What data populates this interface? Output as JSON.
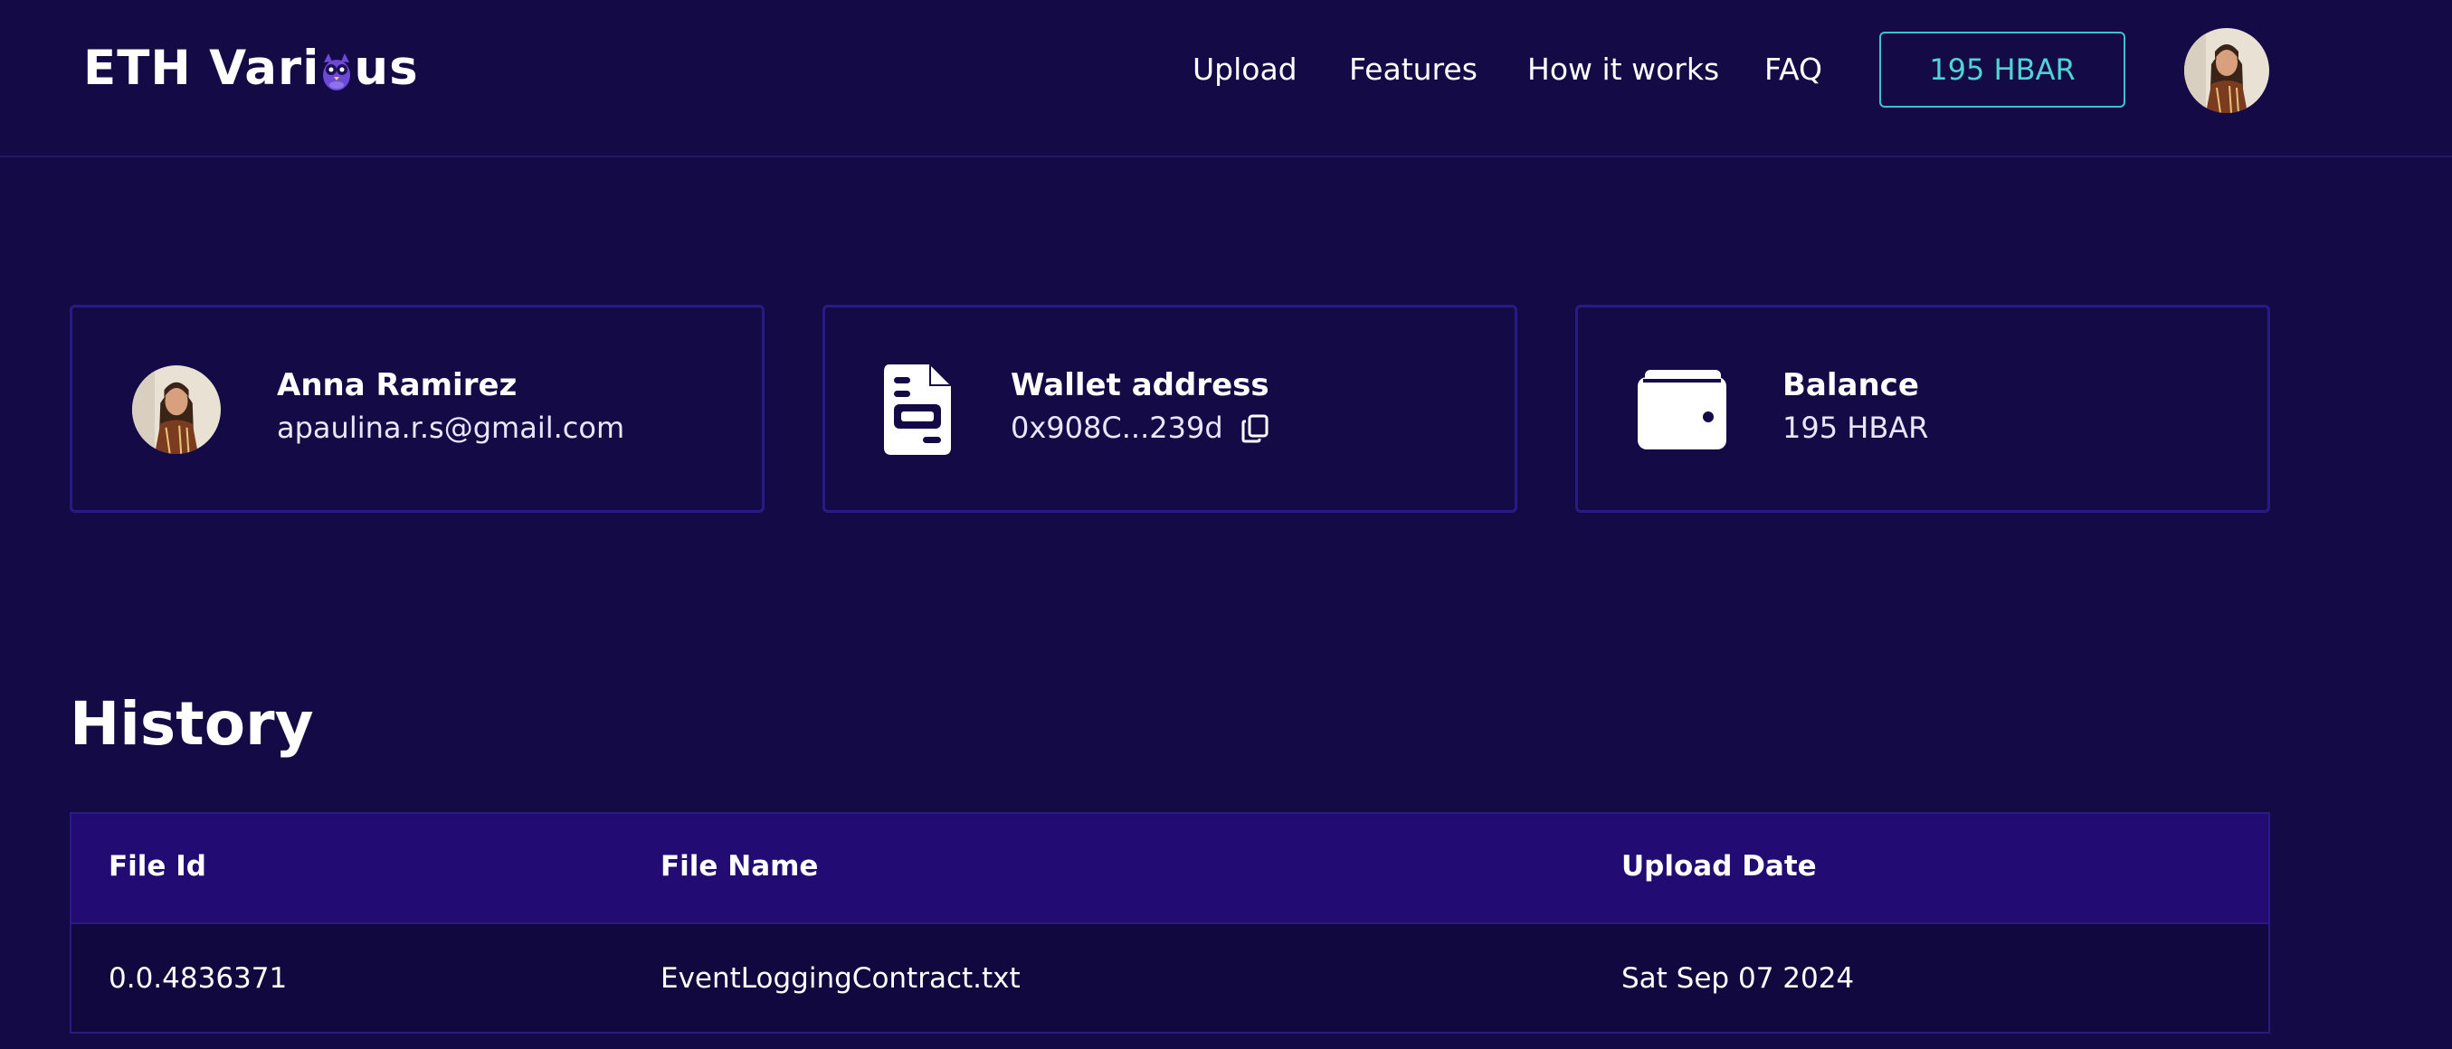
{
  "header": {
    "logo": {
      "text_before": "ETH Vari",
      "text_after": "us"
    },
    "nav": [
      {
        "label": "Upload"
      },
      {
        "label": "Features"
      },
      {
        "label": "How it works"
      },
      {
        "label": "FAQ"
      }
    ],
    "balance_button": "195 HBAR",
    "avatar_icon": "user-avatar-photo"
  },
  "cards": {
    "profile": {
      "name": "Anna Ramirez",
      "email": "apaulina.r.s@gmail.com",
      "icon": "user-avatar-photo"
    },
    "wallet": {
      "title": "Wallet address",
      "address": "0x908C...239d",
      "icon": "document-icon",
      "copy_icon": "copy-icon"
    },
    "balance": {
      "title": "Balance",
      "value": "195 HBAR",
      "icon": "wallet-icon"
    }
  },
  "history": {
    "title": "History",
    "columns": [
      "File Id",
      "File Name",
      "Upload Date"
    ],
    "rows": [
      {
        "file_id": "0.0.4836371",
        "file_name": "EventLoggingContract.txt",
        "upload_date": "Sat Sep 07 2024"
      }
    ]
  },
  "colors": {
    "background": "#140a45",
    "card_border": "#2a1a86",
    "table_header": "#220c74",
    "accent": "#3fc1c9",
    "owl_purple": "#6b4bd6"
  }
}
